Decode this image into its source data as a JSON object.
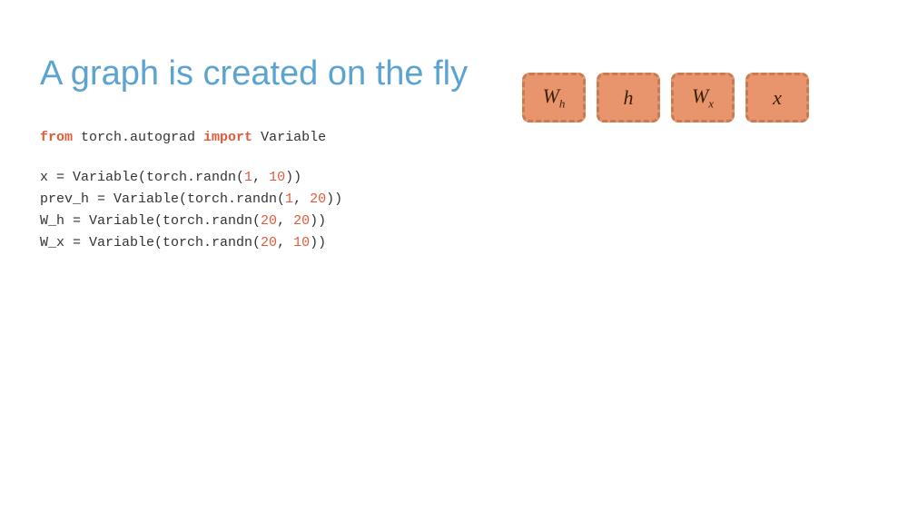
{
  "title": "A graph is created on the fly",
  "code": {
    "line1": "from torch.autograd import Variable",
    "line2": "",
    "line3": "x = Variable(torch.randn(1, 10))",
    "line4": "prev_h = Variable(torch.randn(1, 20))",
    "line5": "W_h = Variable(torch.randn(20, 20))",
    "line6": "W_x = Variable(torch.randn(20, 10))"
  },
  "boxes": [
    {
      "label": "W",
      "sub": "h"
    },
    {
      "label": "h",
      "sub": ""
    },
    {
      "label": "W",
      "sub": "x"
    },
    {
      "label": "x",
      "sub": ""
    }
  ],
  "colors": {
    "title": "#5ba4cf",
    "box_bg": "#e8956d",
    "box_border": "#c97a50",
    "keyword": "#e05b3a",
    "number": "#e05b3a",
    "code_default": "#333333"
  }
}
